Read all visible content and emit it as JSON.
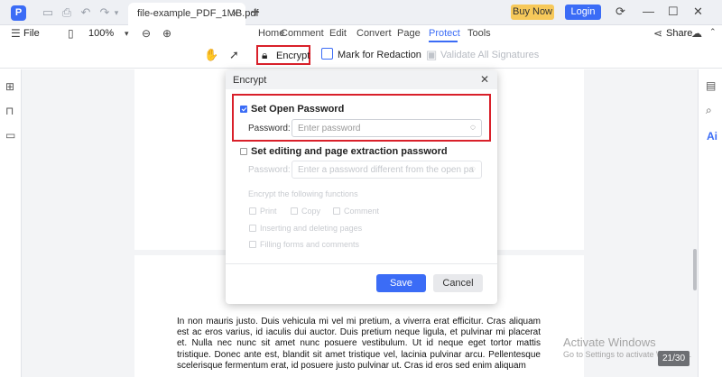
{
  "titlebar": {
    "app_logo": "P",
    "tab_title": "file-example_PDF_1MB.pdf",
    "tab_close": "×",
    "tab_add": "+",
    "buy_now": "Buy Now",
    "login": "Login",
    "icons": [
      "save-icon",
      "print-icon",
      "undo-icon",
      "redo-icon",
      "refresh-icon",
      "minimize-icon",
      "maximize-icon",
      "close-icon"
    ]
  },
  "menubar": {
    "file": "File",
    "zoom": "100%",
    "items": [
      "Home",
      "Comment",
      "Edit",
      "Convert",
      "Page",
      "Protect",
      "Tools"
    ],
    "active": "Protect",
    "share": "Share"
  },
  "toolbar": {
    "encrypt": "Encrypt",
    "mark_for_redaction": "Mark for Redaction",
    "validate_all_signatures": "Validate All Signatures"
  },
  "dialog": {
    "title": "Encrypt",
    "set_open_password": "Set Open Password",
    "set_open_password_checked": true,
    "password_label": "Password:",
    "password_placeholder": "Enter password",
    "set_editing_password": "Set editing and page extraction password",
    "set_editing_password_checked": false,
    "password_label2": "Password:",
    "password_placeholder2": "Enter a password different from the open pa",
    "encrypt_functions_label": "Encrypt the following functions",
    "functions": [
      "Print",
      "Copy",
      "Comment",
      "Inserting and deleting pages",
      "Filling forms and comments"
    ],
    "save": "Save",
    "cancel": "Cancel"
  },
  "document": {
    "text": "In non mauris justo. Duis vehicula mi vel mi pretium, a viverra erat efficitur. Cras aliquam est ac eros varius, id iaculis dui auctor. Duis pretium neque ligula, et pulvinar mi placerat et. Nulla nec nunc sit amet nunc posuere vestibulum. Ut id neque eget tortor mattis tristique. Donec ante est, blandit sit amet tristique vel, lacinia pulvinar arcu. Pellentesque scelerisque fermentum erat, id posuere justo pulvinar ut. Cras id eros sed enim aliquam",
    "watermark_line1": "Activate Windows",
    "watermark_line2": "Go to Settings to activate Windows.",
    "page_indicator": "21/30"
  },
  "right_sidebar": {
    "ai_label": "Ai"
  },
  "colors": {
    "accent": "#3b6cf6",
    "highlight": "#d9202a",
    "buy_now": "#f7c95a"
  }
}
